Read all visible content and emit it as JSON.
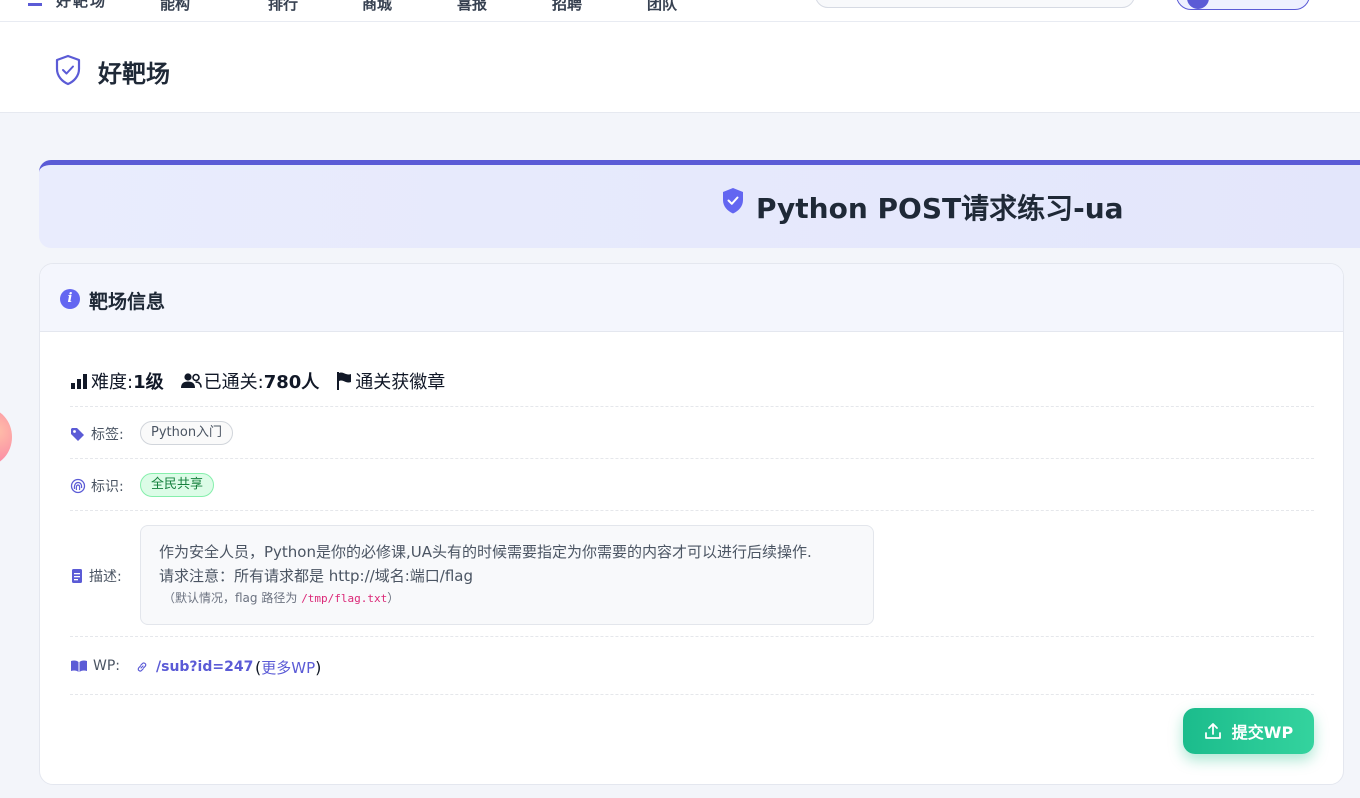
{
  "topnav": {
    "logo_text": "好靶场",
    "items": [
      "能构",
      "排行",
      "商城",
      "喜报",
      "招聘",
      "团队"
    ]
  },
  "header": {
    "title": "好靶场"
  },
  "banner": {
    "title": "Python POST请求练习-ua"
  },
  "card": {
    "title": "靶场信息",
    "stats": {
      "difficulty_label": "难度: ",
      "difficulty_value": "1级",
      "passed_label": "已通关: ",
      "passed_value": "780人",
      "badge_text": "通关获徽章"
    },
    "tags_label": "标签:",
    "tag": "Python入门",
    "mark_label": "标识:",
    "mark": "全民共享",
    "desc_label": "描述:",
    "desc_line1": "作为安全人员，Python是你的必修课,UA头有的时候需要指定为你需要的内容才可以进行后续操作.",
    "desc_line2": "请求注意：所有请求都是 http://域名:端口/flag",
    "desc_note_prefix": "（默认情况，flag 路径为",
    "desc_note_path": "/tmp/flag.txt",
    "desc_note_suffix": "）",
    "wp_label": "WP:",
    "wp_link": "/sub?id=247",
    "wp_more_open": "(",
    "wp_more": "更多WP",
    "wp_more_close": ")",
    "submit_label": "提交WP"
  },
  "colors": {
    "accent": "#5b5bd6",
    "success": "#1bbc8c",
    "tag_green_bg": "#dcfce7",
    "tag_green_text": "#15803d"
  },
  "icons": [
    "shield-check-icon",
    "shield-icon",
    "info-icon",
    "bar-chart-icon",
    "users-icon",
    "flag-icon",
    "tag-icon",
    "fingerprint-icon",
    "document-icon",
    "book-icon",
    "link-icon",
    "upload-icon"
  ]
}
